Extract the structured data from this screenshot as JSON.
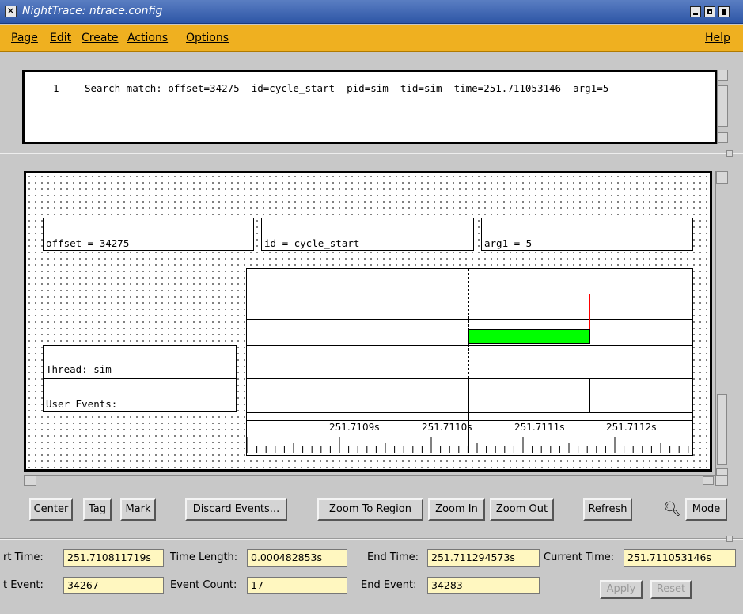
{
  "window": {
    "title": "NightTrace: ntrace.config"
  },
  "menubar": {
    "items": [
      "Page",
      "Edit",
      "Create",
      "Actions",
      "Options"
    ],
    "help": "Help"
  },
  "message": {
    "line_no": "1",
    "text": "Search match: offset=34275  id=cycle_start  pid=sim  tid=sim  time=251.711053146  arg1=5"
  },
  "display": {
    "offset_label": "offset = 34275",
    "id_label": "id = cycle_start",
    "arg_label": "arg1 = 5",
    "thread_label": "Thread: sim",
    "user_events_label": "User Events:",
    "ruler_ticks": [
      "251.7109s",
      "251.7110s",
      "251.7111s",
      "251.7112s"
    ]
  },
  "buttons": {
    "center": "Center",
    "tag": "Tag",
    "mark": "Mark",
    "discard": "Discard Events...",
    "zoom_region": "Zoom To Region",
    "zoom_in": "Zoom In",
    "zoom_out": "Zoom Out",
    "refresh": "Refresh",
    "mode": "Mode"
  },
  "fields": {
    "start_time_label": "rt Time:",
    "start_time": "251.710811719s",
    "time_length_label": "Time Length:",
    "time_length": "0.000482853s",
    "end_time_label": "End Time:",
    "end_time": "251.711294573s",
    "current_time_label": "Current Time:",
    "current_time": "251.711053146s",
    "start_event_label": "t Event:",
    "start_event": "34267",
    "event_count_label": "Event Count:",
    "event_count": "17",
    "end_event_label": "End Event:",
    "end_event": "34283",
    "apply": "Apply",
    "reset": "Reset"
  },
  "colors": {
    "menubar": "#efb020",
    "field_bg": "#fff7c0",
    "state_bar": "#00ff00",
    "event_mark": "#ff0000"
  }
}
